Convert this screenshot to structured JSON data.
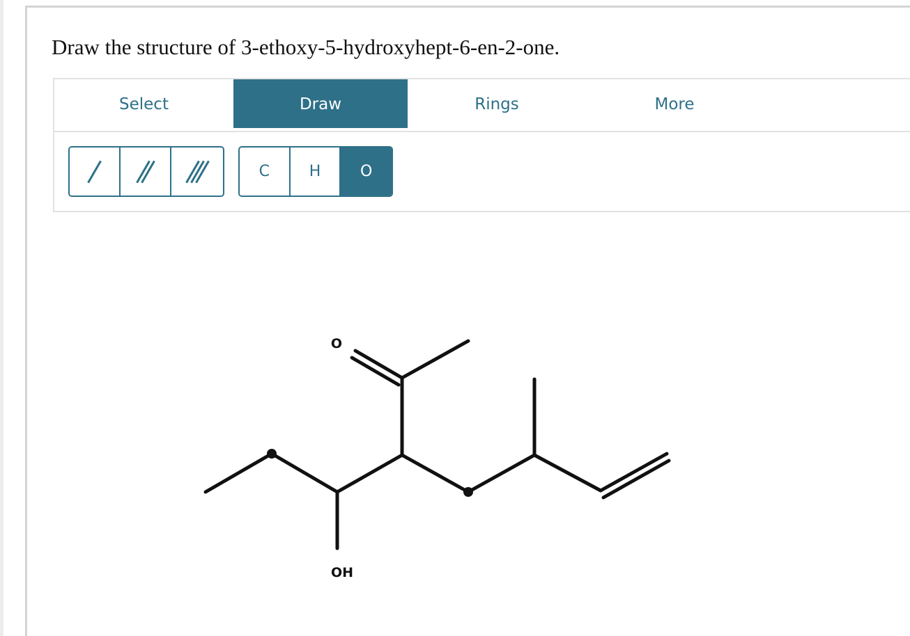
{
  "question": {
    "text": "Draw the structure of 3-ethoxy-5-hydroxyhept-6-en-2-one."
  },
  "tabs": [
    {
      "label": "Select",
      "active": false
    },
    {
      "label": "Draw",
      "active": true
    },
    {
      "label": "Rings",
      "active": false
    },
    {
      "label": "More",
      "active": false
    }
  ],
  "bond_tools": [
    {
      "name": "single-bond-icon"
    },
    {
      "name": "double-bond-icon"
    },
    {
      "name": "triple-bond-icon"
    }
  ],
  "atom_tools": [
    {
      "label": "C",
      "active": false
    },
    {
      "label": "H",
      "active": false
    },
    {
      "label": "O",
      "active": true
    }
  ],
  "molecule": {
    "labels": {
      "carbonyl_o": "O",
      "hydroxyl": "OH"
    }
  },
  "colors": {
    "accent": "#2e7088",
    "border": "#e2e2e2",
    "text": "#111111"
  }
}
